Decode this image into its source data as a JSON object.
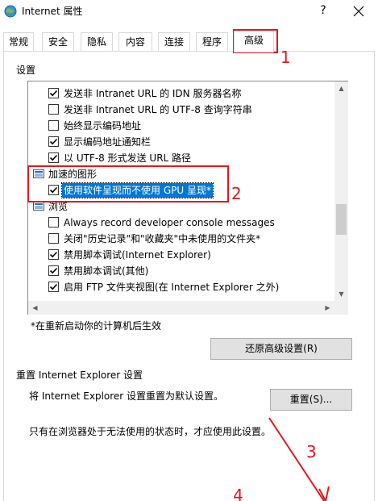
{
  "window": {
    "title": "Internet 属性",
    "help_label": "?",
    "icon": "globe-icon"
  },
  "tabs": [
    {
      "label": "常规"
    },
    {
      "label": "安全"
    },
    {
      "label": "隐私"
    },
    {
      "label": "内容"
    },
    {
      "label": "连接"
    },
    {
      "label": "程序"
    },
    {
      "label": "高级",
      "active": true
    }
  ],
  "settings": {
    "heading": "设置",
    "rows": [
      {
        "type": "checkbox",
        "checked": true,
        "label": "发送非 Intranet URL 的 IDN 服务器名称"
      },
      {
        "type": "checkbox",
        "checked": false,
        "label": "发送非 Intranet URL 的 UTF-8 查询字符串"
      },
      {
        "type": "checkbox",
        "checked": false,
        "label": "始终显示编码地址"
      },
      {
        "type": "checkbox",
        "checked": true,
        "label": "显示编码地址通知栏"
      },
      {
        "type": "checkbox",
        "checked": true,
        "label": "以 UTF-8 形式发送 URL 路径"
      },
      {
        "type": "group",
        "label": "加速的图形"
      },
      {
        "type": "checkbox",
        "checked": true,
        "label": "使用软件呈现而不使用 GPU 呈现*",
        "selected": true
      },
      {
        "type": "group",
        "label": "浏览"
      },
      {
        "type": "checkbox",
        "checked": false,
        "label": "Always record developer console messages"
      },
      {
        "type": "checkbox",
        "checked": false,
        "label": "关闭\"历史记录\"和\"收藏夹\"中未使用的文件夹*"
      },
      {
        "type": "checkbox",
        "checked": true,
        "label": "禁用脚本调试(Internet Explorer)"
      },
      {
        "type": "checkbox",
        "checked": true,
        "label": "禁用脚本调试(其他)"
      },
      {
        "type": "checkbox",
        "checked": true,
        "label": "启用 FTP 文件夹视图(在 Internet Explorer 之外)"
      }
    ],
    "footnote": "*在重新启动你的计算机后生效",
    "restore_button": "还原高级设置(R)"
  },
  "reset": {
    "heading": "重置 Internet Explorer 设置",
    "description": "将 Internet Explorer 设置重置为默认设置。",
    "button": "重置(S)...",
    "note": "只有在浏览器处于无法使用的状态时，才应使用此设置。"
  },
  "annotations": {
    "color": "#e0191f",
    "labels": [
      "1",
      "2",
      "3",
      "4"
    ]
  }
}
